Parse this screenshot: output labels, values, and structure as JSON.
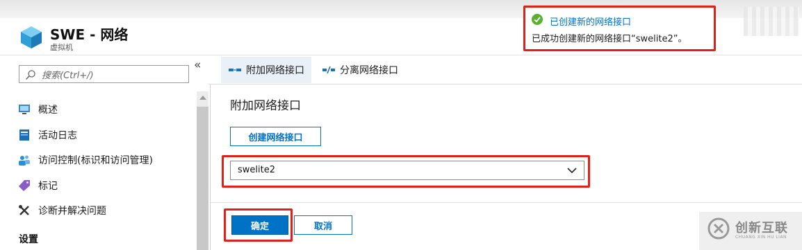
{
  "header": {
    "title": "SWE - 网络",
    "subtitle": "虚拟机"
  },
  "sidebar": {
    "search_placeholder": "搜索(Ctrl+/)",
    "collapse": "«",
    "items": [
      {
        "label": "概述",
        "icon": "monitor-icon"
      },
      {
        "label": "活动日志",
        "icon": "log-icon"
      },
      {
        "label": "访问控制(标识和访问管理)",
        "icon": "people-icon"
      },
      {
        "label": "标记",
        "icon": "tag-icon"
      },
      {
        "label": "诊断并解决问题",
        "icon": "wrench-icon"
      }
    ],
    "section_header": "设置"
  },
  "toolbar": {
    "attach_label": "附加网络接口",
    "detach_label": "分离网络接口"
  },
  "blade": {
    "title": "附加网络接口",
    "create_label": "创建网络接口",
    "selected_nic": "swelite2",
    "ok_label": "确定",
    "cancel_label": "取消"
  },
  "notification": {
    "title": "已创建新的网络接口",
    "message": "已成功创建新的网络接口“swelite2”。",
    "status": "success"
  },
  "watermark": {
    "text": "创新互联",
    "sub": "CHUANG XIN HU LIAN"
  },
  "colors": {
    "accent": "#0072c6",
    "highlight": "#e0201b",
    "success": "#5ab031"
  }
}
